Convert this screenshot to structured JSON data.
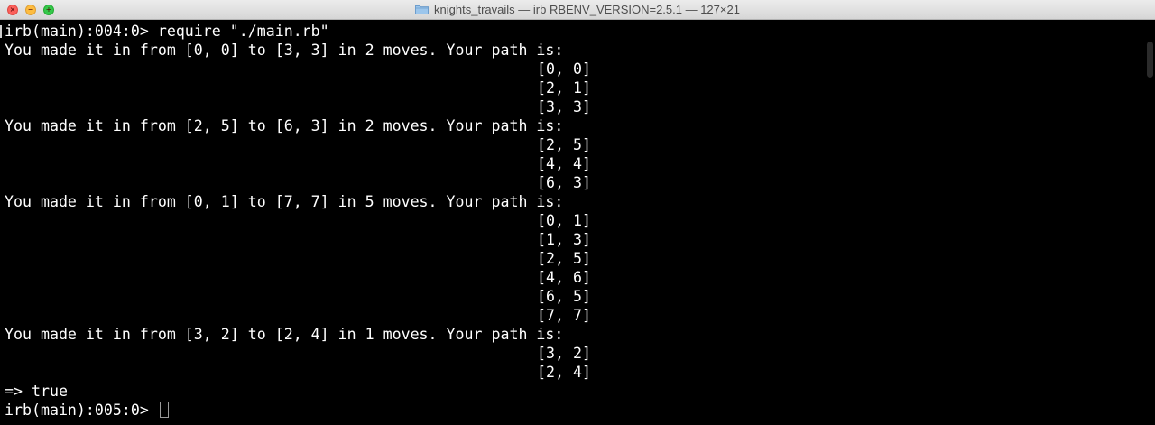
{
  "window": {
    "folder_name": "knights_travails",
    "title_rest": " — irb RBENV_VERSION=2.5.1 — 127×21",
    "close_icon": "close-icon",
    "minimize_icon": "minimize-icon",
    "zoom_icon": "zoom-icon",
    "folder_icon": "folder-icon"
  },
  "colors": {
    "background": "#000000",
    "text": "#ffffff"
  },
  "terminal": {
    "prompt_line": "irb(main):004:0> require \"./main.rb\"",
    "results": [
      {
        "summary": "You made it in from [0, 0] to [3, 3] in 2 moves. Your path is:",
        "path": [
          "[0, 0]",
          "[2, 1]",
          "[3, 3]"
        ]
      },
      {
        "summary": "You made it in from [2, 5] to [6, 3] in 2 moves. Your path is:",
        "path": [
          "[2, 5]",
          "[4, 4]",
          "[6, 3]"
        ]
      },
      {
        "summary": "You made it in from [0, 1] to [7, 7] in 5 moves. Your path is:",
        "path": [
          "[0, 1]",
          "[1, 3]",
          "[2, 5]",
          "[4, 6]",
          "[6, 5]",
          "[7, 7]"
        ]
      },
      {
        "summary": "You made it in from [3, 2] to [2, 4] in 1 moves. Your path is:",
        "path": [
          "[3, 2]",
          "[2, 4]"
        ]
      }
    ],
    "return_line": "=> true",
    "final_prompt": "irb(main):005:0> "
  }
}
